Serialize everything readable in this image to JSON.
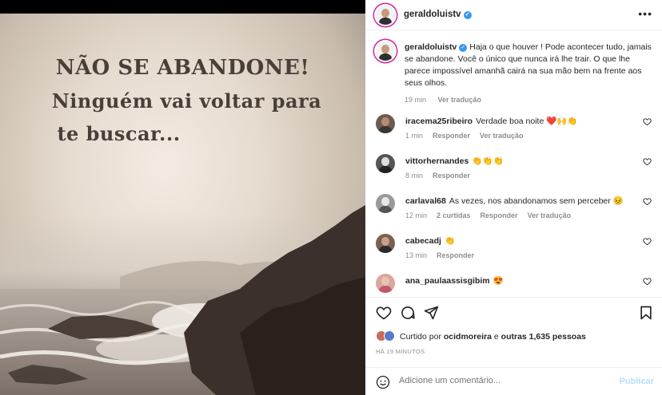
{
  "image": {
    "line1": "NÃO SE ABANDONE!",
    "line2": "Ninguém vai voltar para",
    "line3": "te buscar..."
  },
  "header": {
    "username": "geraldoluistv",
    "more_icon": "more-horizontal-icon"
  },
  "caption": {
    "username": "geraldoluistv",
    "text": "Haja o que houver ! Pode acontecer tudo, jamais se abandone. Você o único que nunca irá lhe trair. O que lhe parece impossível amanhã cairá na sua mão bem na frente aos seus olhos.",
    "age": "19 min",
    "translate": "Ver tradução"
  },
  "comments": [
    {
      "username": "iracema25ribeiro",
      "text": "Verdade boa noite ❤️🙌👏",
      "age": "1 min",
      "reply": "Responder",
      "likes": "",
      "translate": "Ver tradução"
    },
    {
      "username": "vittorhernandes",
      "text": "👏👏👏",
      "age": "8 min",
      "reply": "Responder",
      "likes": "",
      "translate": ""
    },
    {
      "username": "carlaval68",
      "text": "As vezes, nos abandonamos sem perceber 😣",
      "age": "12 min",
      "reply": "Responder",
      "likes": "2 curtidas",
      "translate": "Ver tradução"
    },
    {
      "username": "cabecadj",
      "text": "👏",
      "age": "13 min",
      "reply": "Responder",
      "likes": "",
      "translate": ""
    },
    {
      "username": "ana_paulaassisgibim",
      "text": "😍",
      "age": "",
      "reply": "",
      "likes": "",
      "translate": ""
    }
  ],
  "likes": {
    "prefix": "Curtido por",
    "user": "ocidmoreira",
    "conj": "e",
    "others": "outras 1,635 pessoas"
  },
  "timestamp": "HÁ 19 MINUTOS",
  "comment_box": {
    "placeholder": "Adicione um comentário...",
    "post": "Publicar"
  },
  "colors": {
    "accent": "#3897f0",
    "post_disabled": "#b2dffc",
    "muted": "#8e8e8e"
  }
}
